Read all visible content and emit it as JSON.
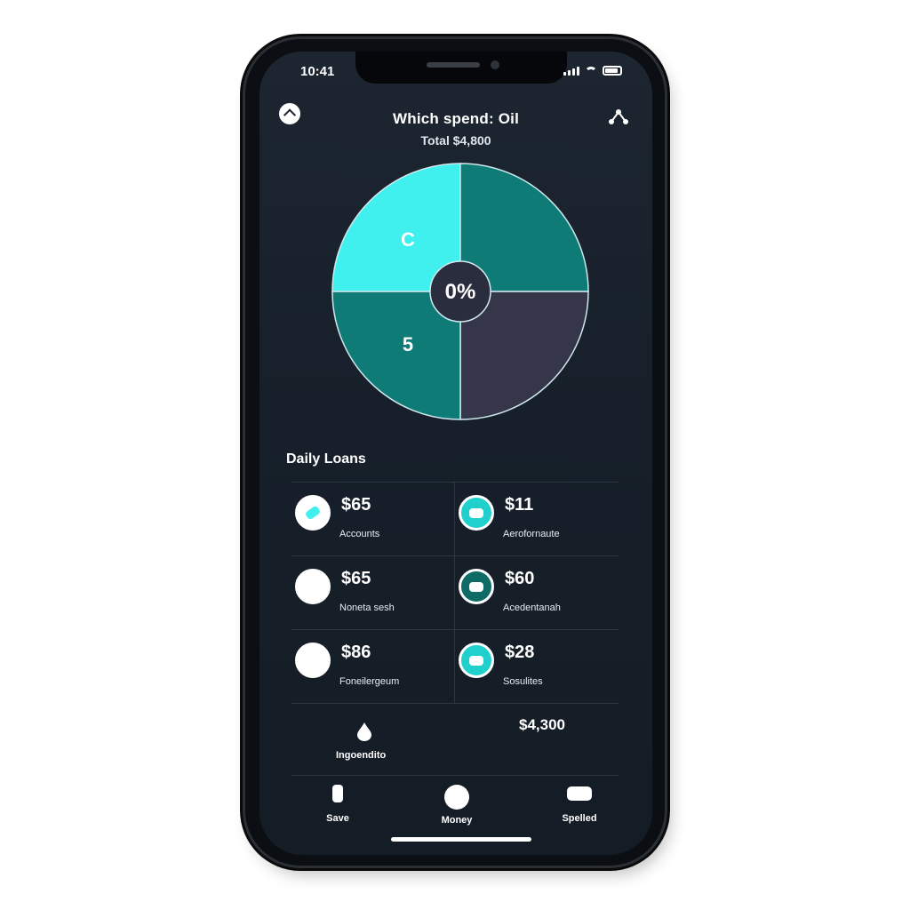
{
  "status_bar": {
    "time": "10:41"
  },
  "header": {
    "title": "Which spend: Oil",
    "subtitle": "Total $4,800"
  },
  "chart_data": {
    "type": "pie",
    "title": "",
    "center_label": "0%",
    "slices": [
      {
        "label": "C",
        "value": 25,
        "color": "#3ff0ee"
      },
      {
        "label": "",
        "value": 25,
        "color": "#0e7b76"
      },
      {
        "label": "",
        "value": 25,
        "color": "#353649"
      },
      {
        "label": "5",
        "value": 25,
        "color": "#0e7b76"
      }
    ]
  },
  "section": {
    "title": "Daily Loans"
  },
  "items": [
    {
      "value": "$65",
      "label": "Accounts",
      "icon": "pill-icon",
      "ring": "#ffffff",
      "fill": "#ffffff",
      "glyph": "#3ff0ee"
    },
    {
      "value": "$11",
      "label": "Aerofornaute",
      "icon": "card-icon",
      "ring": "#ffffff",
      "fill": "#20d0cc",
      "glyph": "#ffffff"
    },
    {
      "value": "$65",
      "label": "Noneta sesh",
      "icon": "circle-icon",
      "ring": "#ffffff",
      "fill": "#ffffff",
      "glyph": "#ffffff"
    },
    {
      "value": "$60",
      "label": "Acedentanah",
      "icon": "card-icon",
      "ring": "#ffffff",
      "fill": "#0e6b68",
      "glyph": "#ffffff"
    },
    {
      "value": "$86",
      "label": "Foneilergeum",
      "icon": "circle-icon",
      "ring": "#ffffff",
      "fill": "#ffffff",
      "glyph": "#ffffff"
    },
    {
      "value": "$28",
      "label": "Sosulites",
      "icon": "cloud-icon",
      "ring": "#ffffff",
      "fill": "#20d0cc",
      "glyph": "#ffffff"
    }
  ],
  "total": {
    "label": "Ingoendito",
    "value": "$4,300"
  },
  "tabs": [
    {
      "label": "Save",
      "icon": "phone-icon"
    },
    {
      "label": "Money",
      "icon": "globe-icon"
    },
    {
      "label": "Spelled",
      "icon": "card-icon"
    }
  ]
}
